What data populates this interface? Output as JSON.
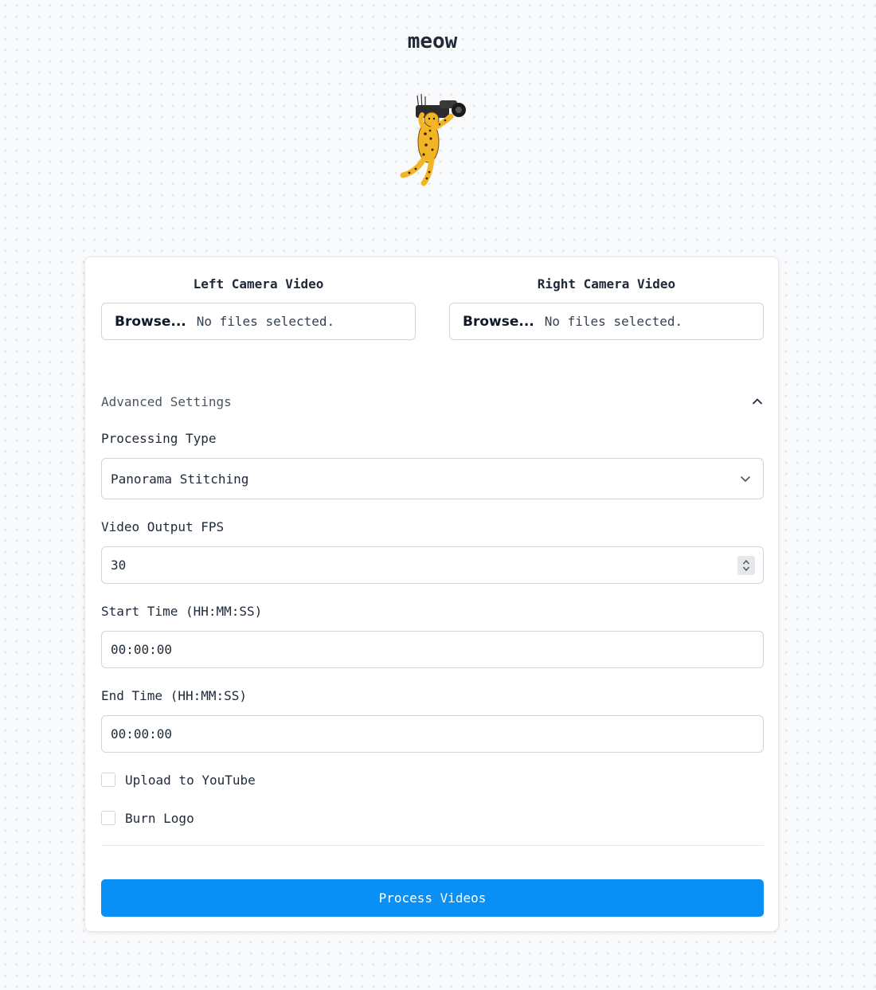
{
  "header": {
    "title": "meow"
  },
  "upload": {
    "left": {
      "label": "Left Camera Video",
      "browse": "Browse...",
      "status": "No files selected."
    },
    "right": {
      "label": "Right Camera Video",
      "browse": "Browse...",
      "status": "No files selected."
    }
  },
  "advanced": {
    "title": "Advanced Settings",
    "expanded": true,
    "processing_type": {
      "label": "Processing Type",
      "value": "Panorama Stitching"
    },
    "fps": {
      "label": "Video Output FPS",
      "value": "30"
    },
    "start_time": {
      "label": "Start Time (HH:MM:SS)",
      "value": "00:00:00"
    },
    "end_time": {
      "label": "End Time (HH:MM:SS)",
      "value": "00:00:00"
    },
    "upload_youtube": {
      "label": "Upload to YouTube",
      "checked": false
    },
    "burn_logo": {
      "label": "Burn Logo",
      "checked": false
    }
  },
  "actions": {
    "process": "Process Videos"
  },
  "colors": {
    "primary": "#0a8ff5",
    "background": "#f9fafb",
    "border": "#d1d5db"
  }
}
